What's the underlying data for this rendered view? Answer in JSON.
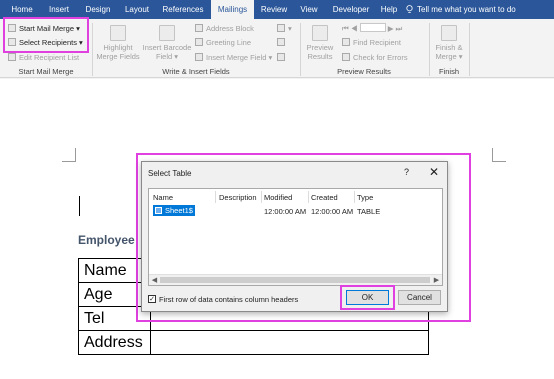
{
  "tabs": [
    "Home",
    "Insert",
    "Design",
    "Layout",
    "References",
    "Mailings",
    "Review",
    "View",
    "Developer",
    "Help"
  ],
  "active_tab": "Mailings",
  "tell_me": "Tell me what you want to do",
  "ribbon": {
    "start_mail_merge": "Start Mail Merge",
    "select_recipients": "Select Recipients",
    "edit_recipient_list": "Edit Recipient List",
    "group_start": "Start Mail Merge",
    "highlight_1": "Highlight",
    "highlight_2": "Merge Fields",
    "insert_barcode_1": "Insert Barcode",
    "insert_barcode_2": "Field",
    "address_block": "Address Block",
    "greeting_line": "Greeting Line",
    "insert_merge_field": "Insert Merge Field",
    "group_write": "Write & Insert Fields",
    "preview_1": "Preview",
    "preview_2": "Results",
    "find_recipient": "Find Recipient",
    "check_errors": "Check for Errors",
    "group_preview": "Preview Results",
    "finish_1": "Finish &",
    "finish_2": "Merge",
    "group_finish": "Finish"
  },
  "document": {
    "heading": "Employee",
    "rows": [
      "Name",
      "Age",
      "Tel",
      "Address"
    ]
  },
  "dialog": {
    "title": "Select Table",
    "help": "?",
    "close": "✕",
    "columns": [
      "Name",
      "Description",
      "Modified",
      "Created",
      "Type"
    ],
    "row": {
      "name": "Sheet1$",
      "description": "",
      "modified": "12:00:00 AM",
      "created": "12:00:00 AM",
      "type": "TABLE"
    },
    "checkbox_checked": true,
    "checkbox_label": "First row of data contains column headers",
    "ok": "OK",
    "cancel": "Cancel"
  },
  "colors": {
    "tab_bar": "#2b579a",
    "highlight": "#e040e0",
    "selection": "#0078d7"
  }
}
